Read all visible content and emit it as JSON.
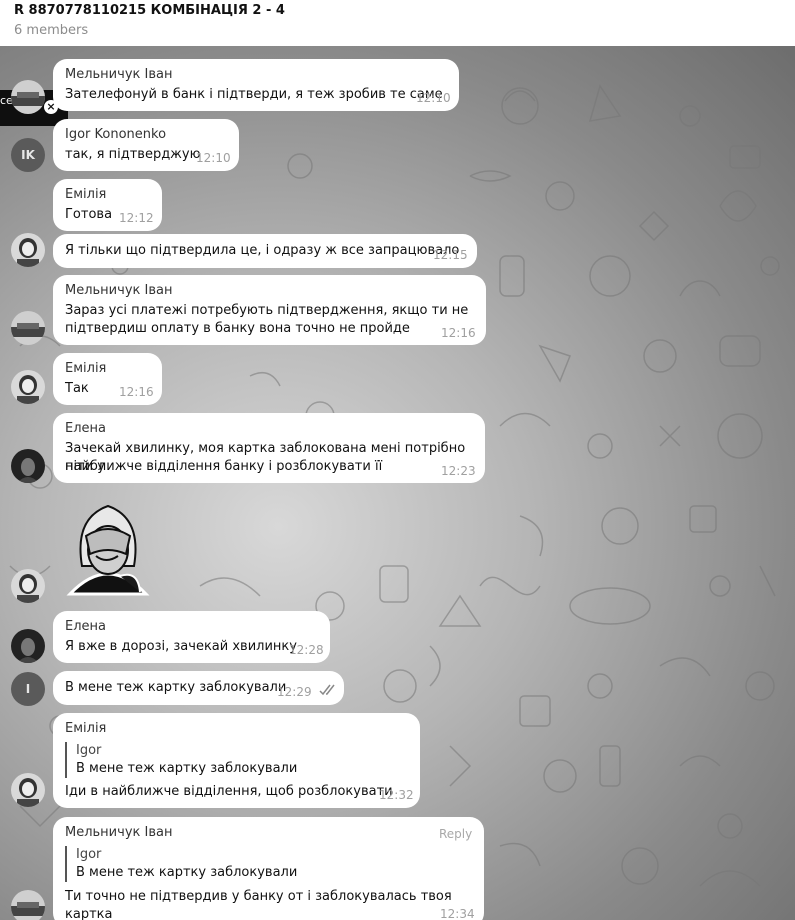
{
  "header": {
    "title": "R 8870778110215 КОМБІНАЦІЯ 2 - 4",
    "subtitle": "6 members"
  },
  "toast": {
    "text": "ces"
  },
  "messages": [
    {
      "name": "Мельничук Іван",
      "lines": [
        "Зателефонуй в банк і підтверди, я теж зробив те саме"
      ],
      "time": "12:10"
    },
    {
      "name": "Igor Kononenko",
      "lines": [
        "так, я підтверджую"
      ],
      "time": "12:10",
      "initials": "IK"
    },
    {
      "name": "Емілія",
      "lines": [
        "Готова"
      ],
      "time": "12:12"
    },
    {
      "name": "",
      "lines": [
        "Я тільки що підтвердила це, і одразу ж все запрацювало"
      ],
      "time": "12:15"
    },
    {
      "name": "Мельничук Іван",
      "lines": [
        "Зараз усі платежі потребують підтвердження, якщо ти не",
        "підтвердиш оплату в банку вона точно не пройде"
      ],
      "time": "12:16"
    },
    {
      "name": "Емілія",
      "lines": [
        "Так"
      ],
      "time": "12:16"
    },
    {
      "name": "Елена",
      "lines": [
        "Зачекай хвилинку, моя картка заблокована мені потрібно піти у",
        "найближче відділення банку і розблокувати її"
      ],
      "time": "12:23"
    },
    {
      "name": "Елена",
      "lines": [
        "Я вже в дорозі, зачекай хвилинку"
      ],
      "time": "12:28"
    },
    {
      "name": "",
      "lines": [
        "В мене теж картку заблокували"
      ],
      "time": "12:29",
      "initials": "I"
    },
    {
      "name": "Емілія",
      "quote_name": "Igor",
      "quote_text": "В мене теж картку заблокували",
      "lines": [
        "Іди в найближче відділення, щоб розблокувати"
      ],
      "time": "12:32"
    },
    {
      "name": "Мельничук Іван",
      "reply": "Reply",
      "quote_name": "Igor",
      "quote_text": "В мене теж картку заблокували",
      "lines": [
        "Ти точно не підтвердив у банку от і заблокувалась твоя картка"
      ],
      "time": "12:34"
    }
  ],
  "colors": {
    "bubble": "#ffffff",
    "time": "#a0a0a0",
    "avatar_initials_bg": "#5a5a5a"
  },
  "icons": {
    "toast_close": "close-icon",
    "read_status": "double-check-icon",
    "sticker": "facepalm-sticker"
  }
}
